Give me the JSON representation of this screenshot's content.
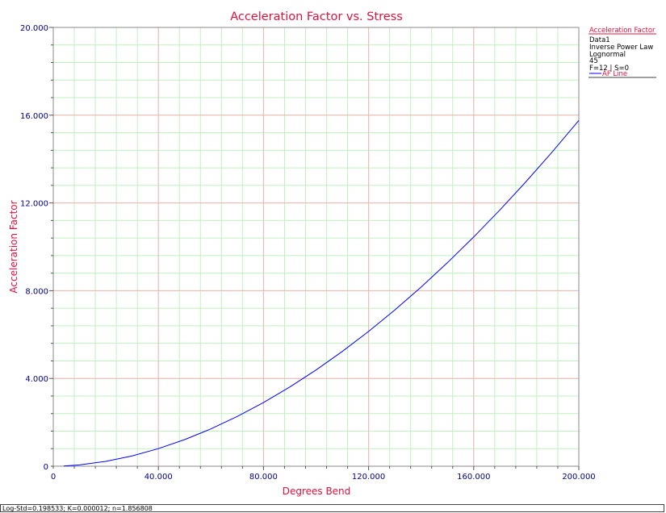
{
  "colors": {
    "title": "#e0103c",
    "axis_text": "#00008b",
    "major_grid": "#f4b3b3",
    "minor_grid": "#bff0bf",
    "series": "#0000ff",
    "legend_text": "#000000"
  },
  "status_text": "Log-Std=0.198533; K=0.000012; n=1.856808",
  "chart_data": {
    "type": "line",
    "title": "Acceleration Factor vs. Stress",
    "xlabel": "Degrees Bend",
    "ylabel": "Acceleration Factor",
    "xlim": [
      0,
      200
    ],
    "ylim": [
      0,
      20
    ],
    "x_major_ticks": [
      40,
      80,
      120,
      160,
      200
    ],
    "x_tick_labels": [
      "40.000",
      "80.000",
      "120.000",
      "160.000",
      "200.000"
    ],
    "x_origin_label": "0",
    "y_major_ticks": [
      4,
      8,
      12,
      16,
      20
    ],
    "y_tick_labels": [
      "4.000",
      "8.000",
      "12.000",
      "16.000",
      "20.000"
    ],
    "y_origin_label": "0",
    "x_minor_step": 8,
    "y_minor_step": 0.8,
    "grid": true,
    "legend": {
      "placement": "right",
      "header": "Acceleration Factor",
      "info_lines": [
        "Data1",
        "Inverse Power Law",
        "Lognormal",
        "45",
        "F=12 | S=0"
      ],
      "series_label": "AF Line"
    },
    "series": [
      {
        "name": "AF Line",
        "model": "inverse-power-law",
        "K": 1.2e-05,
        "n": 1.856808,
        "reference_stress": 45,
        "x": [
          4,
          10,
          20,
          30,
          40,
          50,
          60,
          70,
          80,
          90,
          100,
          110,
          120,
          130,
          140,
          150,
          160,
          170,
          180,
          190,
          200
        ],
        "values": [
          0.011,
          0.061,
          0.221,
          0.469,
          0.802,
          1.213,
          1.702,
          2.266,
          2.902,
          3.609,
          4.387,
          5.232,
          6.145,
          7.124,
          8.168,
          9.277,
          10.449,
          11.684,
          12.982,
          14.341,
          15.761
        ]
      }
    ]
  }
}
